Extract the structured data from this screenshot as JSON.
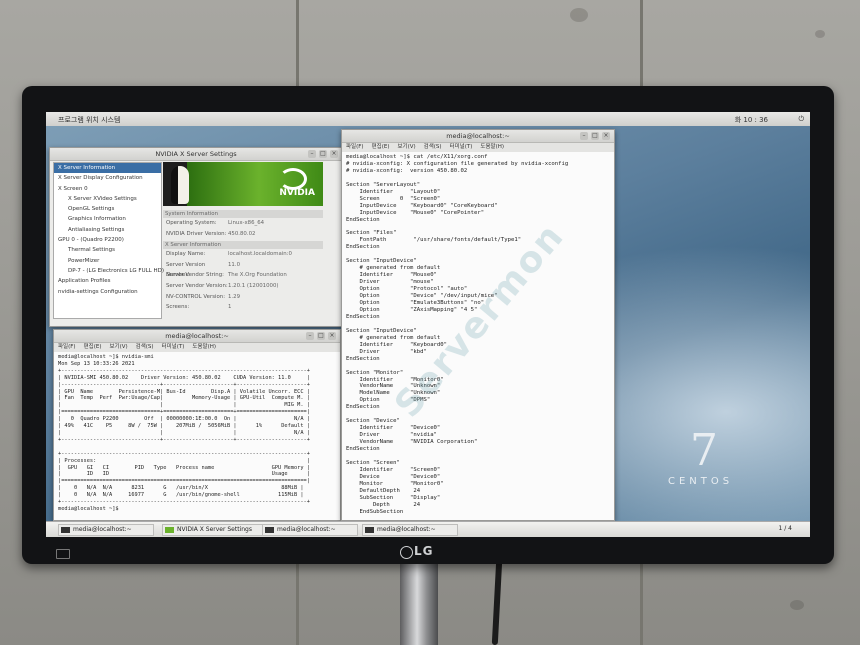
{
  "topbar": {
    "left": "프로그램    위치    시스템",
    "right": "화  10 : 36"
  },
  "nvidia_window": {
    "title": "NVIDIA X Server Settings",
    "tree": [
      "X Server Information",
      "X Server Display Configuration",
      "X Screen 0",
      "X Server XVideo Settings",
      "OpenGL Settings",
      "Graphics Information",
      "Antialiasing Settings",
      "GPU 0 - (Quadro P2200)",
      "Thermal Settings",
      "PowerMizer",
      "DP-7 - (LG Electronics LG FULL HD)",
      "Application Profiles",
      "nvidia-settings Configuration"
    ],
    "logo": "NVIDIA",
    "section_system": "System Information",
    "os_label": "Operating System:",
    "os_value": "Linux-x86_64",
    "driver_label": "NVIDIA Driver Version:",
    "driver_value": "450.80.02",
    "section_xserver": "X Server Information",
    "display_label": "Display Name:",
    "display_value": "localhost.localdomain:0",
    "sv_label": "Server Version Number:",
    "sv_value": "11.0",
    "vendor_label": "Server Vendor String:",
    "vendor_value": "The X.Org Foundation",
    "vendor_ver_label": "Server Vendor Version:",
    "vendor_ver_value": "1.20.1 (12001000)",
    "nvctrl_label": "NV-CONTROL Version:",
    "nvctrl_value": "1.29",
    "screens_label": "Screens:",
    "screens_value": "1"
  },
  "smi_window": {
    "title": "media@localhost:~",
    "menu": [
      "파일(F)",
      "편집(E)",
      "보기(V)",
      "검색(S)",
      "터미널(T)",
      "도움말(H)"
    ],
    "text": "media@localhost ~]$ nvidia-smi\nMon Sep 13 10:33:26 2021\n+-----------------------------------------------------------------------------+\n| NVIDIA-SMI 450.80.02    Driver Version: 450.80.02    CUDA Version: 11.0     |\n|-------------------------------+----------------------+----------------------+\n| GPU  Name        Persistence-M| Bus-Id        Disp.A | Volatile Uncorr. ECC |\n| Fan  Temp  Perf  Pwr:Usage/Cap|         Memory-Usage | GPU-Util  Compute M. |\n|                               |                      |               MIG M. |\n|===============================+======================+======================|\n|   0  Quadro P2200        Off  | 00000000:1E:00.0  On |                  N/A |\n| 49%   41C    P5     8W /  75W |    207MiB /  5056MiB |      1%      Default |\n|                               |                      |                  N/A |\n+-------------------------------+----------------------+----------------------+\n\n+-----------------------------------------------------------------------------+\n| Processes:                                                                  |\n|  GPU   GI   CI        PID   Type   Process name                  GPU Memory |\n|        ID   ID                                                   Usage      |\n|=============================================================================|\n|    0   N/A  N/A      8231      G   /usr/bin/X                       88MiB |\n|    0   N/A  N/A     16977      G   /usr/bin/gnome-shell            115MiB |\n+-----------------------------------------------------------------------------+\nmedia@localhost ~]$ "
  },
  "xorg_window": {
    "title": "media@localhost:~",
    "menu": [
      "파일(F)",
      "편집(E)",
      "보기(V)",
      "검색(S)",
      "터미널(T)",
      "도움말(H)"
    ],
    "text": "media@localhost ~]$ cat /etc/X11/xorg.conf\n# nvidia-xconfig: X configuration file generated by nvidia-xconfig\n# nvidia-xconfig:  version 450.80.02\n\nSection \"ServerLayout\"\n    Identifier     \"Layout0\"\n    Screen      0  \"Screen0\"\n    InputDevice    \"Keyboard0\" \"CoreKeyboard\"\n    InputDevice    \"Mouse0\" \"CorePointer\"\nEndSection\n\nSection \"Files\"\n    FontPath        \"/usr/share/fonts/default/Type1\"\nEndSection\n\nSection \"InputDevice\"\n    # generated from default\n    Identifier     \"Mouse0\"\n    Driver         \"mouse\"\n    Option         \"Protocol\" \"auto\"\n    Option         \"Device\" \"/dev/input/mice\"\n    Option         \"Emulate3Buttons\" \"no\"\n    Option         \"ZAxisMapping\" \"4 5\"\nEndSection\n\nSection \"InputDevice\"\n    # generated from default\n    Identifier     \"Keyboard0\"\n    Driver         \"kbd\"\nEndSection\n\nSection \"Monitor\"\n    Identifier     \"Monitor0\"\n    VendorName     \"Unknown\"\n    ModelName      \"Unknown\"\n    Option         \"DPMS\"\nEndSection\n\nSection \"Device\"\n    Identifier     \"Device0\"\n    Driver         \"nvidia\"\n    VendorName     \"NVIDIA Corporation\"\nEndSection\n\nSection \"Screen\"\n    Identifier     \"Screen0\"\n    Device         \"Device0\"\n    Monitor        \"Monitor0\"\n    DefaultDepth    24\n    SubSection     \"Display\"\n        Depth       24\n    EndSubSection"
  },
  "desktop": {
    "seven": "7",
    "centos": "CENTOS"
  },
  "taskbar": {
    "items": [
      "media@localhost:~",
      "NVIDIA X Server Settings",
      "media@localhost:~",
      "media@localhost:~"
    ],
    "pager": "1 / 4"
  },
  "monitor": {
    "brand": "LG"
  },
  "watermark": "Servermon"
}
